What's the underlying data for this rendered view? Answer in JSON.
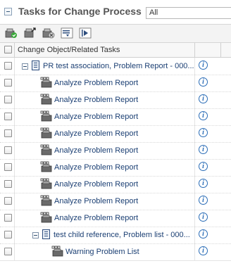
{
  "header": {
    "title": "Tasks for Change Process",
    "filter_value": "All"
  },
  "toolbar": {
    "icons": [
      "task-complete-icon",
      "task-export-icon",
      "task-cancel-icon",
      "task-menu-icon",
      "task-run-icon"
    ]
  },
  "table": {
    "column_header": "Change Object/Related Tasks"
  },
  "rows": [
    {
      "label": "PR test association, Problem Report - 000...",
      "kind": "change-object"
    },
    {
      "label": "Analyze Problem Report",
      "kind": "task"
    },
    {
      "label": "Analyze Problem Report",
      "kind": "task"
    },
    {
      "label": "Analyze Problem Report",
      "kind": "task"
    },
    {
      "label": "Analyze Problem Report",
      "kind": "task"
    },
    {
      "label": "Analyze Problem Report",
      "kind": "task"
    },
    {
      "label": "Analyze Problem Report",
      "kind": "task"
    },
    {
      "label": "Analyze Problem Report",
      "kind": "task"
    },
    {
      "label": "Analyze Problem Report",
      "kind": "task"
    },
    {
      "label": "Analyze Problem Report",
      "kind": "task"
    },
    {
      "label": "test child reference, Problem list - 000...",
      "kind": "change-object"
    },
    {
      "label": "Warning Problem List",
      "kind": "task"
    }
  ],
  "info_symbol": "i"
}
